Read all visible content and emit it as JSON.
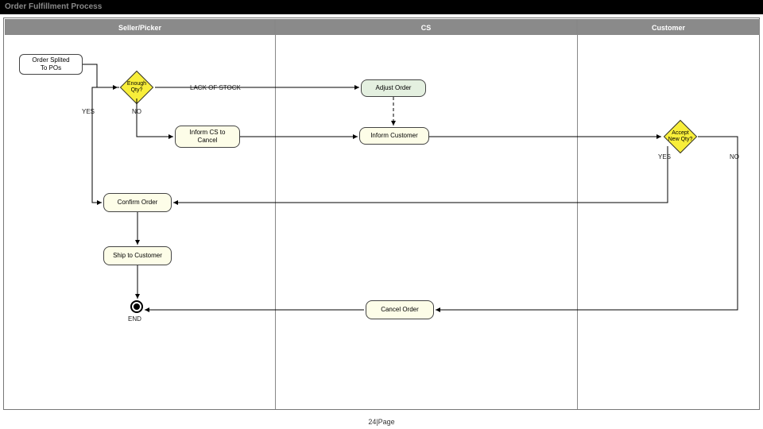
{
  "title": "Order Fulfillment Process",
  "footer": "24|Page",
  "lanes": {
    "seller": "Seller/Picker",
    "cs": "CS",
    "customer": "Customer"
  },
  "nodes": {
    "start": "Order Splited\nTo POs",
    "enough_qty": "Enough\nQty?",
    "lack_of_stock": "LACK OF STOCK",
    "inform_cs": "Inform CS to\nCancel",
    "adjust_order": "Adjust Order",
    "inform_customer": "Inform Customer",
    "accept_qty": "Accept\nNew Qty?",
    "confirm_order": "Confirm Order",
    "ship": "Ship to Customer",
    "cancel_order": "Cancel Order",
    "end_label": "END"
  },
  "edge_labels": {
    "yes1": "YES",
    "no1": "NO",
    "yes2": "YES",
    "no2": "NO"
  }
}
